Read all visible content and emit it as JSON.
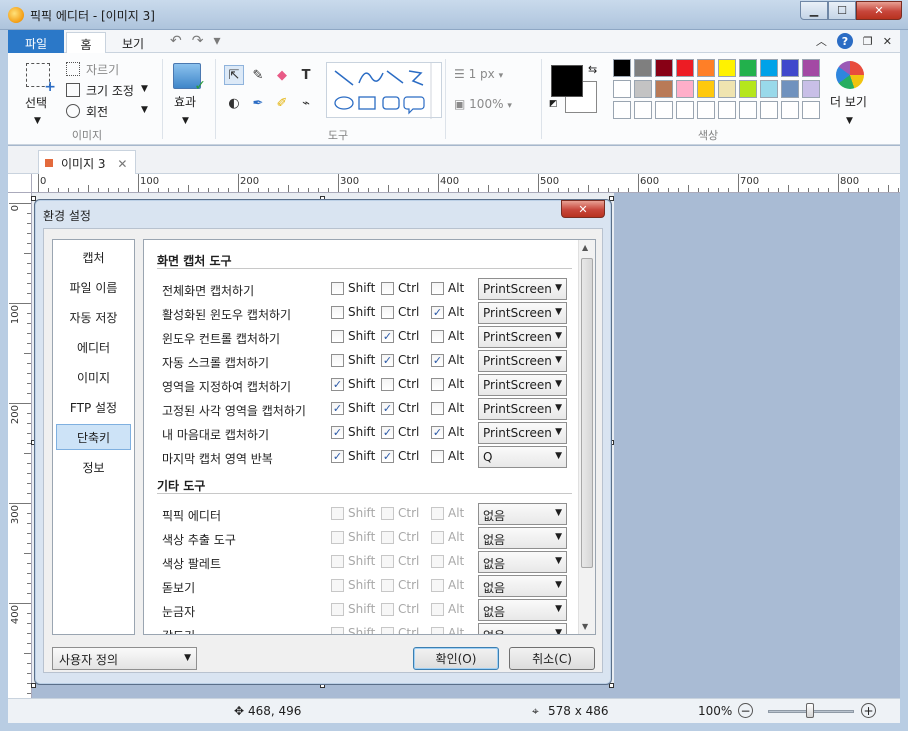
{
  "window": {
    "title": "픽픽 에디터 - [이미지 3]",
    "min": "▁",
    "max": "☐",
    "close": "✕"
  },
  "tabs": {
    "file": "파일",
    "home": "홈",
    "view": "보기"
  },
  "qat": {
    "undo": "↶",
    "redo": "↷",
    "more": "▾"
  },
  "ribbon_right": {
    "collapse": "︿",
    "help": "?",
    "restore": "❐",
    "close": "✕"
  },
  "ribbon": {
    "image_group": {
      "select": "선택",
      "crop": "자르기",
      "resize": "크기 조정",
      "rotate": "회전",
      "label": "이미지"
    },
    "effect": "효과",
    "tools_label": "도구",
    "line_width": "1 px",
    "opacity": "100%",
    "colors_label": "색상",
    "more_colors": "더 보기",
    "palette": [
      "#000000",
      "#7f7f7f",
      "#880015",
      "#ed1c24",
      "#ff7f27",
      "#fff200",
      "#22b14c",
      "#00a2e8",
      "#3f48cc",
      "#a349a4",
      "#ffffff",
      "#c3c3c3",
      "#b97a57",
      "#ffaec9",
      "#ffc90e",
      "#efe4b0",
      "#b5e61d",
      "#99d9ea",
      "#7092be",
      "#c8bfe7",
      "#ffffff",
      "#ffffff",
      "#ffffff",
      "#ffffff",
      "#ffffff",
      "#ffffff",
      "#ffffff",
      "#ffffff",
      "#ffffff",
      "#ffffff"
    ]
  },
  "doc_tab": {
    "label": "이미지 3",
    "close": "✕"
  },
  "ruler": {
    "h": [
      "0",
      "100",
      "200",
      "300",
      "400",
      "500",
      "600",
      "700",
      "800"
    ],
    "v": [
      "0",
      "100",
      "200",
      "300",
      "400"
    ]
  },
  "dialog": {
    "title": "환경 설정",
    "close": "✕",
    "nav": [
      "캡처",
      "파일 이름",
      "자동 저장",
      "에디터",
      "이미지",
      "FTP 설정",
      "단축키",
      "정보"
    ],
    "active_nav": "단축키",
    "section1": "화면 캡처 도구",
    "section2": "기타 도구",
    "mods": {
      "shift": "Shift",
      "ctrl": "Ctrl",
      "alt": "Alt"
    },
    "capture_rows": [
      {
        "label": "전체화면 캡처하기",
        "shift": false,
        "ctrl": false,
        "alt": false,
        "key": "PrintScreen"
      },
      {
        "label": "활성화된 윈도우 캡처하기",
        "shift": false,
        "ctrl": false,
        "alt": true,
        "key": "PrintScreen"
      },
      {
        "label": "윈도우 컨트롤 캡처하기",
        "shift": false,
        "ctrl": true,
        "alt": false,
        "key": "PrintScreen"
      },
      {
        "label": "자동 스크롤 캡처하기",
        "shift": false,
        "ctrl": true,
        "alt": true,
        "key": "PrintScreen"
      },
      {
        "label": "영역을 지정하여 캡처하기",
        "shift": true,
        "ctrl": false,
        "alt": false,
        "key": "PrintScreen"
      },
      {
        "label": "고정된 사각 영역을 캡처하기",
        "shift": true,
        "ctrl": true,
        "alt": false,
        "key": "PrintScreen"
      },
      {
        "label": "내 마음대로 캡처하기",
        "shift": true,
        "ctrl": true,
        "alt": true,
        "key": "PrintScreen"
      },
      {
        "label": "마지막 캡처 영역 반복",
        "shift": true,
        "ctrl": true,
        "alt": false,
        "key": "Q"
      }
    ],
    "other_rows": [
      {
        "label": "픽픽 에디터",
        "key": "없음"
      },
      {
        "label": "색상 추출 도구",
        "key": "없음"
      },
      {
        "label": "색상 팔레트",
        "key": "없음"
      },
      {
        "label": "돋보기",
        "key": "없음"
      },
      {
        "label": "눈금자",
        "key": "없음"
      },
      {
        "label": "각도기",
        "key": "없음"
      }
    ],
    "preset": "사용자 정의",
    "ok": "확인(O)",
    "cancel": "취소(C)"
  },
  "status": {
    "cursor": "468, 496",
    "size": "578 x 486",
    "zoom": "100%",
    "zoom_out": "−",
    "zoom_in": "+"
  }
}
